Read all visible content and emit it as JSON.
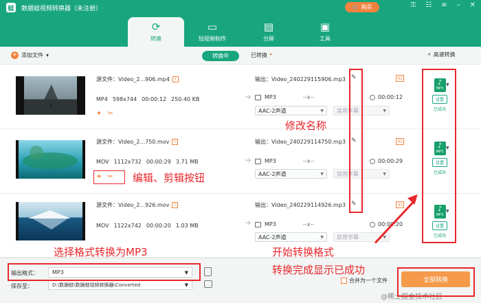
{
  "app": {
    "title": "数据蛙视频转换器（未注册）",
    "buy": "购买",
    "logo": "蛙"
  },
  "nav": {
    "tabs": [
      {
        "label": "转换",
        "icon": "convert-icon"
      },
      {
        "label": "短视频制作",
        "icon": "tv-icon"
      },
      {
        "label": "分屏",
        "icon": "split-icon"
      },
      {
        "label": "工具",
        "icon": "toolbox-icon"
      }
    ]
  },
  "toolbar": {
    "add_file": "添加文件",
    "converting": "转换中",
    "done": "已转换",
    "fast": "高速转换"
  },
  "files": [
    {
      "src": "源文件：Video_2...906.mp4",
      "fmt": "MP4",
      "res": "598x744",
      "dur": "00:00:12",
      "size": "250.40 KB",
      "out": "输出：Video_240229115906.mp3",
      "out_fmt": "MP3",
      "out_res": "--x--",
      "out_dur": "00:00:12",
      "audio": "AAC-2声道",
      "sub": "禁用字幕"
    },
    {
      "src": "源文件：Video_2...750.mov",
      "fmt": "MOV",
      "res": "1112x732",
      "dur": "00:00:29",
      "size": "3.71 MB",
      "out": "输出：Video_240229114750.mp3",
      "out_fmt": "MP3",
      "out_res": "--x--",
      "out_dur": "00:00:29",
      "audio": "AAC-2声道",
      "sub": "禁用字幕"
    },
    {
      "src": "源文件：Video_2...926.mov",
      "fmt": "MOV",
      "res": "1122x742",
      "dur": "00:00:20",
      "size": "1.03 MB",
      "out": "输出：Video_240229114926.mp3",
      "out_fmt": "MP3",
      "out_res": "--x--",
      "out_dur": "00:00:20",
      "audio": "AAC-2声道",
      "sub": "禁用字幕"
    }
  ],
  "format_box": {
    "label": "MP3",
    "set": "设置",
    "status": "已成功"
  },
  "bottom": {
    "out_label": "输出格式：",
    "out_value": "MP3",
    "save_label": "保存至：",
    "save_value": "D:\\数据蛙\\数据蛙视频转换器\\Converted",
    "merge": "合并为一个文件",
    "convert_all": "全部转换",
    "watermark": "@稀土掘金技术社区"
  },
  "annotations": {
    "rename": "修改名称",
    "edit": "编辑、剪辑按钮",
    "format": "选择格式转换为MP3",
    "start": "开始转换格式",
    "done": "转换完成显示已成功"
  }
}
